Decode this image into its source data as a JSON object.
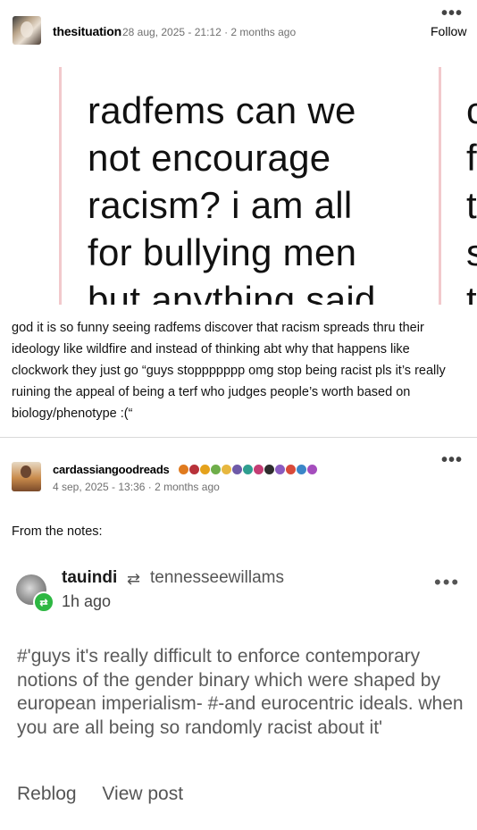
{
  "post1": {
    "username": "thesituation",
    "meta": "28 aug, 2025 - 21:12 · 2 months ago",
    "more": "•••",
    "follow": "Follow",
    "image_text": "radfems can we\nnot encourage\nracism? i am all\nfor bullying men\nbut anything said",
    "image_text_right": "c\nf\nt\ns\nt",
    "body": "god it is so funny seeing radfems discover that racism spreads thru their ideology like wildfire and instead of thinking abt why that happens like clockwork they just go “guys stoppppppp omg stop being racist pls it’s really ruining the appeal of being a terf who judges people’s worth based on biology/phenotype :(“"
  },
  "post2": {
    "username": "cardassiangoodreads",
    "meta": "4 sep, 2025 - 13:36 · 2 months ago",
    "more": "•••",
    "notes_label": "From the notes:",
    "badge_colors": [
      "#e07b1f",
      "#b8323a",
      "#e5a21c",
      "#6fae4a",
      "#e7b73f",
      "#6e5aa8",
      "#2f9e8f",
      "#c43d74",
      "#2d2d2d",
      "#8a5bc0",
      "#d94a3a",
      "#3a86c8",
      "#a54dbd"
    ]
  },
  "note": {
    "username": "tauindi",
    "reblog_icon": "⇄",
    "source": "tennesseewillams",
    "time": "1h ago",
    "more": "•••",
    "tags": "#'guys it's really difficult to enforce contemporary notions of the gender binary which were shaped by european imperialism-  #-and eurocentric ideals. when you are all being so randomly racist about it'",
    "actions": {
      "reblog": "Reblog",
      "view_post": "View post"
    }
  }
}
